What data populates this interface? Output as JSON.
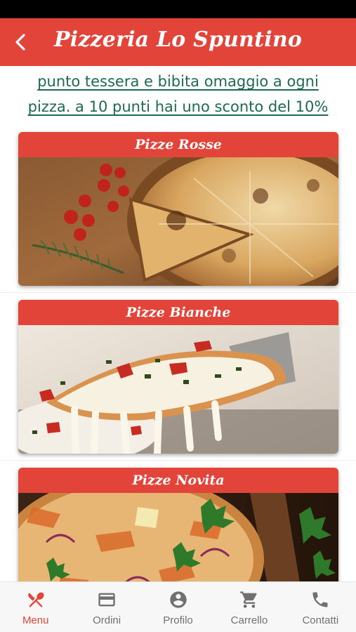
{
  "app_bar": {
    "title": "Pizzeria Lo Spuntino",
    "back_icon": "chevron-left-icon"
  },
  "promo": {
    "text": "punto tessera e bibita omaggio a ogni pizza. a 10 punti hai uno sconto del 10%"
  },
  "categories": [
    {
      "title": "Pizze Rosse"
    },
    {
      "title": "Pizze Bianche"
    },
    {
      "title": "Pizze Novita"
    }
  ],
  "bottom_nav": {
    "active": "Menu",
    "items": [
      {
        "label": "Menu",
        "icon": "fork-knife-icon"
      },
      {
        "label": "Ordini",
        "icon": "credit-card-icon"
      },
      {
        "label": "Profilo",
        "icon": "account-circle-icon"
      },
      {
        "label": "Carrello",
        "icon": "cart-icon"
      },
      {
        "label": "Contatti",
        "icon": "phone-icon"
      }
    ]
  },
  "colors": {
    "primary": "#e3443a",
    "promo_text": "#1d6b4e",
    "nav_inactive": "#707070"
  }
}
